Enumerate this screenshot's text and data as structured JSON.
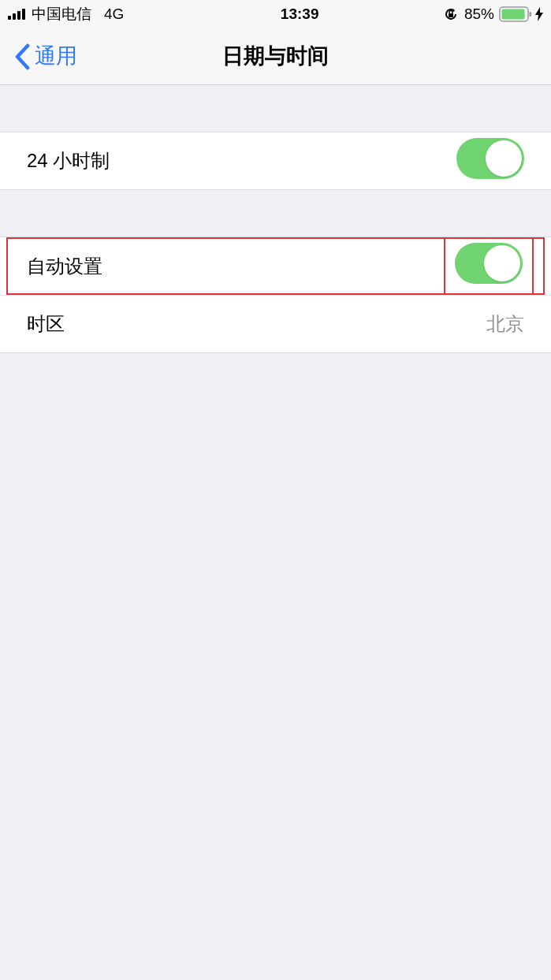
{
  "status_bar": {
    "carrier": "中国电信",
    "network": "4G",
    "time": "13:39",
    "battery": "85%"
  },
  "nav": {
    "back": "通用",
    "title": "日期与时间"
  },
  "sections": [
    {
      "rows": [
        {
          "kind": "toggle",
          "label": "24 小时制",
          "on": true,
          "highlighted": false
        }
      ]
    },
    {
      "rows": [
        {
          "kind": "toggle",
          "label": "自动设置",
          "on": true,
          "highlighted": true
        },
        {
          "kind": "value",
          "label": "时区",
          "value": "北京",
          "highlighted": false
        }
      ]
    }
  ]
}
